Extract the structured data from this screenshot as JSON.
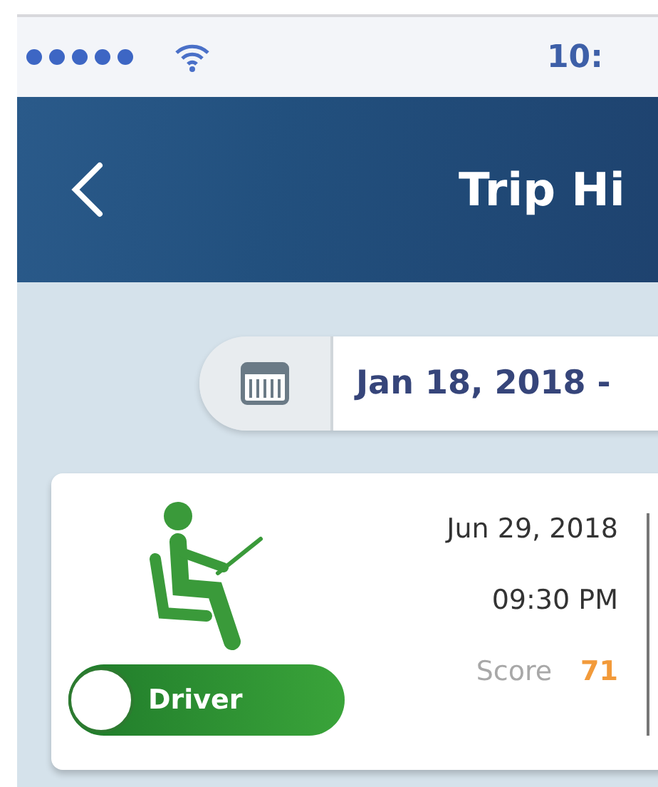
{
  "status_bar": {
    "time": "10:"
  },
  "header": {
    "title": "Trip Hi"
  },
  "date_range": {
    "value": "Jan 18, 2018 -"
  },
  "trip": {
    "date": "Jun 29, 2018",
    "time": "09:30 PM",
    "score_label": "Score",
    "score": "71",
    "toggle": {
      "label": "Driver",
      "on": true
    }
  }
}
